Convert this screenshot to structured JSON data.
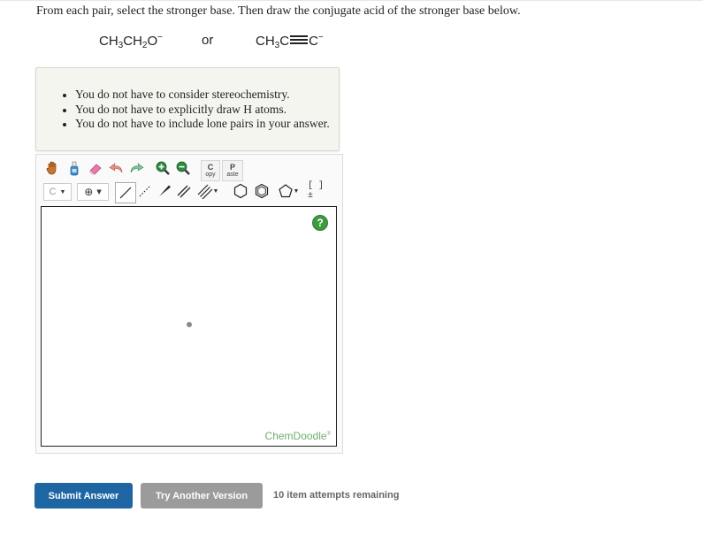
{
  "question": "From each pair, select the stronger base. Then draw the conjugate acid of the stronger base below.",
  "pair": {
    "left": {
      "a": "CH",
      "a_sub": "3",
      "b": "CH",
      "b_sub": "2",
      "c": "O",
      "charge": "−"
    },
    "or": "or",
    "right": {
      "a": "CH",
      "a_sub": "3",
      "b": "C",
      "c": "C",
      "charge": "−"
    }
  },
  "notes": [
    "You do not have to consider stereochemistry.",
    "You do not have to explicitly draw H atoms.",
    "You do not have to include lone pairs in your answer."
  ],
  "toolbar": {
    "copy_label_top": "C",
    "copy_label_bottom": "opy",
    "paste_label_top": "P",
    "paste_label_bottom": "aste",
    "carbon_label": "C",
    "charge_label": "⊕",
    "bracket_label": "[ ]±"
  },
  "editor": {
    "help_label": "?",
    "brand": "ChemDoodle",
    "brand_mark": "®"
  },
  "buttons": {
    "submit": "Submit Answer",
    "try_another": "Try Another Version"
  },
  "attempts_text": "10 item attempts remaining",
  "colors": {
    "submit_bg": "#1e66a3",
    "try_bg": "#9b9b9b",
    "brand": "#6fae6f"
  },
  "icons": [
    "hand-icon",
    "bottle-icon",
    "eraser-icon",
    "undo-icon",
    "redo-icon",
    "zoom-in-icon",
    "zoom-out-icon",
    "single-bond-icon",
    "dashed-bond-icon",
    "wedge-bond-icon",
    "double-bond-icon",
    "triple-bond-icon",
    "benzene-icon",
    "cyclohexane-icon",
    "cyclopentane-icon",
    "help-icon"
  ]
}
